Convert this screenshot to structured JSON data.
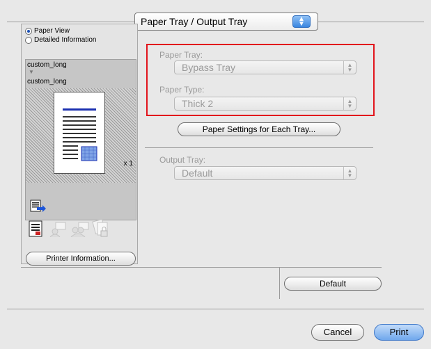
{
  "pane_selector": {
    "label": "Paper Tray / Output Tray"
  },
  "view_options": [
    {
      "label": "Paper View",
      "selected": true
    },
    {
      "label": "Detailed Information",
      "selected": false
    }
  ],
  "preview": {
    "media_top": "custom_long",
    "media_bottom": "custom_long",
    "copies": "x 1"
  },
  "printer_info_button": "Printer Information...",
  "paper_tray": {
    "label": "Paper Tray:",
    "value": "Bypass Tray"
  },
  "paper_type": {
    "label": "Paper Type:",
    "value": "Thick 2"
  },
  "paper_settings_button": "Paper Settings for Each Tray...",
  "output_tray": {
    "label": "Output Tray:",
    "value": "Default"
  },
  "default_button": "Default",
  "cancel_button": "Cancel",
  "print_button": "Print",
  "colors": {
    "highlight_border": "#e2141c",
    "accent": "#3a86e0"
  }
}
